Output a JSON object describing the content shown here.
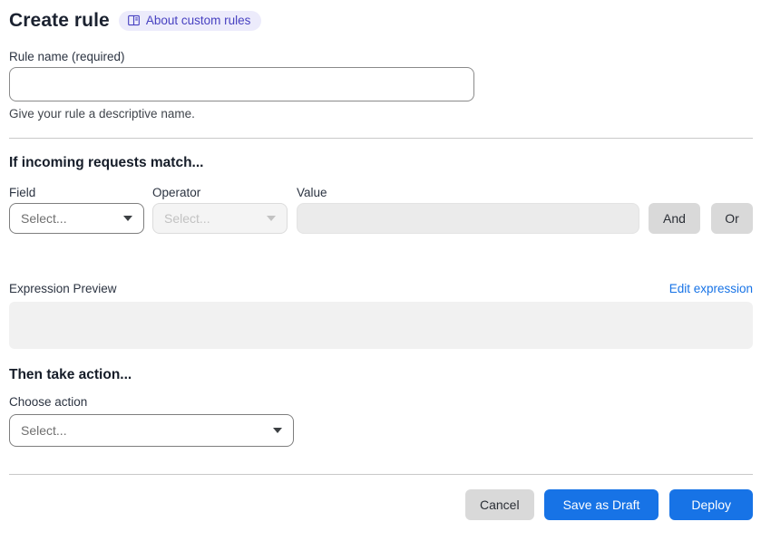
{
  "header": {
    "title": "Create rule",
    "badge": {
      "label": "About custom rules",
      "icon": "book-icon"
    }
  },
  "rule_name": {
    "label": "Rule name (required)",
    "value": "",
    "helper": "Give your rule a descriptive name."
  },
  "match_section": {
    "heading": "If incoming requests match...",
    "field": {
      "label": "Field",
      "selected": "Select..."
    },
    "operator": {
      "label": "Operator",
      "selected": "Select...",
      "state": "disabled"
    },
    "value": {
      "label": "Value",
      "value": "",
      "state": "disabled"
    },
    "and_button": "And",
    "or_button": "Or"
  },
  "expression": {
    "label": "Expression Preview",
    "edit_link": "Edit expression",
    "content": ""
  },
  "action_section": {
    "heading": "Then take action...",
    "choose_label": "Choose action",
    "selected": "Select..."
  },
  "footer": {
    "cancel": "Cancel",
    "save_draft": "Save as Draft",
    "deploy": "Deploy"
  },
  "colors": {
    "primary_blue": "#1773e6",
    "link_blue": "#1773e6",
    "badge_bg": "#ecebfb",
    "badge_text": "#4741c1",
    "chip_gray": "#d9d9d9",
    "preview_gray": "#f1f1f1"
  }
}
